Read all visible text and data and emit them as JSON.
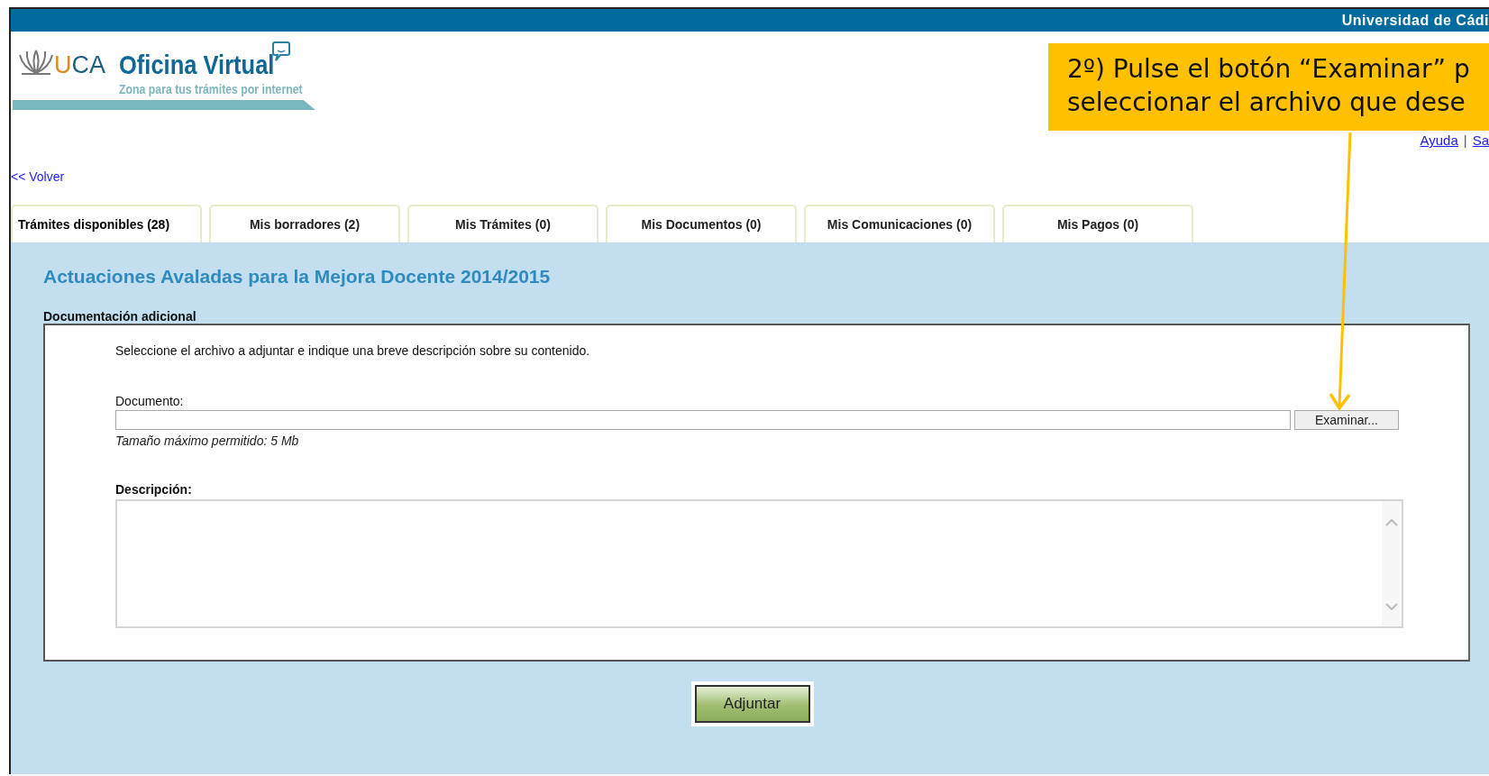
{
  "top_bar": {
    "title": "Universidad de Cádi"
  },
  "logo": {
    "brand": "UCA",
    "name": "Oficina Virtual",
    "tagline": "Zona para tus trámites por internet"
  },
  "header_links": [
    "Ayuda",
    "|",
    "Sa"
  ],
  "callout": {
    "lines": [
      "2º) Pulse el botón “Examinar” p",
      "seleccionar el archivo que dese"
    ]
  },
  "back_link": "<< Volver",
  "tabs": [
    {
      "label": "Trámites disponibles (28)",
      "selected": true
    },
    {
      "label": "Mis borradores (2)",
      "selected": false
    },
    {
      "label": "Mis Trámites (0)",
      "selected": false
    },
    {
      "label": "Mis Documentos (0)",
      "selected": false
    },
    {
      "label": "Mis Comunicaciones (0)",
      "selected": false
    },
    {
      "label": "Mis Pagos (0)",
      "selected": false
    }
  ],
  "page_title": "Actuaciones Avaladas para la Mejora Docente 2014/2015",
  "section": {
    "title": "Documentación adicional",
    "intro": "Seleccione el archivo a adjuntar e indique una breve descripción sobre su contenido.",
    "document_label": "Documento:",
    "browse_button": "Examinar...",
    "size_hint": "Tamaño máximo permitido: 5 Mb",
    "description_label": "Descripción:"
  },
  "submit_button": "Adjuntar"
}
